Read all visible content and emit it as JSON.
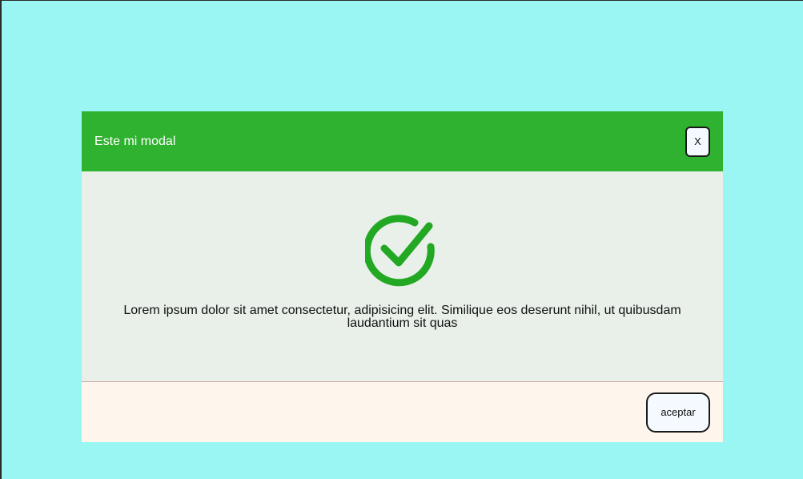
{
  "colors": {
    "page_background": "#99f6f2",
    "header_background": "#2fb22f",
    "body_background": "#e8f0e9",
    "footer_background": "#fef5ed",
    "check_icon": "#22a822"
  },
  "modal": {
    "title": "Este mi modal",
    "close_label": "X",
    "icon": "check-circle-icon",
    "message": "Lorem ipsum dolor sit amet consectetur, adipisicing elit. Similique eos deserunt nihil, ut quibusdam laudantium sit quas",
    "accept_label": "aceptar"
  }
}
